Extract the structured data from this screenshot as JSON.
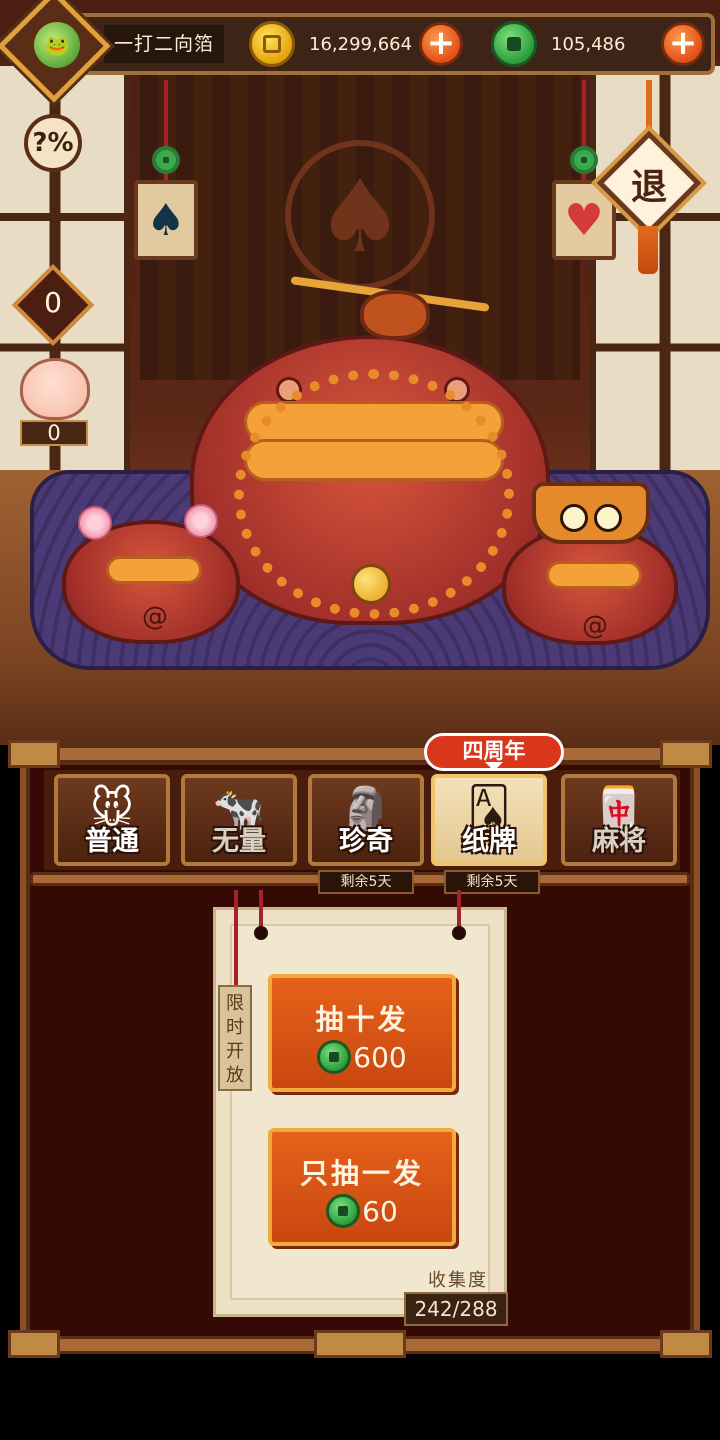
{
  "player": {
    "name": "一打二向箔"
  },
  "currency": {
    "gold": "16,299,664",
    "jade": "105,486"
  },
  "widgets": {
    "counter_value": "0",
    "pig_count": "0"
  },
  "exit_label": "退",
  "tabs": [
    {
      "label": "普通",
      "art": "🐭"
    },
    {
      "label": "无量",
      "art": "🐄"
    },
    {
      "label": "珍奇",
      "art": "🗿",
      "timer": "剩余5天"
    },
    {
      "label": "纸牌",
      "art": "🂡",
      "timer": "剩余5天",
      "badge": "四周年",
      "active": true
    },
    {
      "label": "麻将",
      "art": "🀄"
    }
  ],
  "limited_tag": [
    "限",
    "时",
    "开",
    "放"
  ],
  "draw_ten": {
    "label": "抽十发",
    "price": "600"
  },
  "draw_one": {
    "label": "只抽一发",
    "price": "60"
  },
  "collection": {
    "label": "收集度",
    "value": "242/288"
  },
  "colors": {
    "accent_orange": "#e0501a",
    "jade_green": "#2d9c3d",
    "gold": "#e4a40d",
    "panel_bg": "#350a05"
  }
}
